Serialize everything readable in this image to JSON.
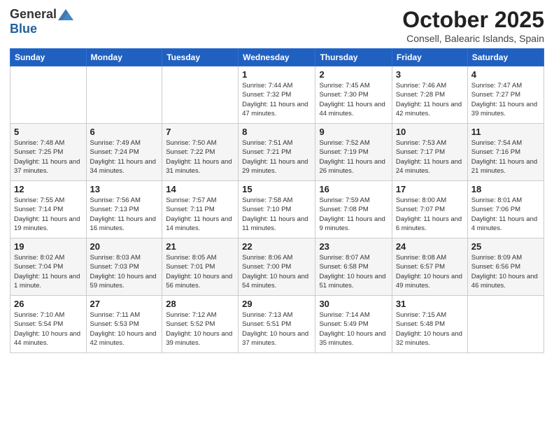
{
  "header": {
    "logo_general": "General",
    "logo_blue": "Blue",
    "month_title": "October 2025",
    "location": "Consell, Balearic Islands, Spain"
  },
  "weekdays": [
    "Sunday",
    "Monday",
    "Tuesday",
    "Wednesday",
    "Thursday",
    "Friday",
    "Saturday"
  ],
  "weeks": [
    [
      {
        "day": "",
        "info": ""
      },
      {
        "day": "",
        "info": ""
      },
      {
        "day": "",
        "info": ""
      },
      {
        "day": "1",
        "info": "Sunrise: 7:44 AM\nSunset: 7:32 PM\nDaylight: 11 hours\nand 47 minutes."
      },
      {
        "day": "2",
        "info": "Sunrise: 7:45 AM\nSunset: 7:30 PM\nDaylight: 11 hours\nand 44 minutes."
      },
      {
        "day": "3",
        "info": "Sunrise: 7:46 AM\nSunset: 7:28 PM\nDaylight: 11 hours\nand 42 minutes."
      },
      {
        "day": "4",
        "info": "Sunrise: 7:47 AM\nSunset: 7:27 PM\nDaylight: 11 hours\nand 39 minutes."
      }
    ],
    [
      {
        "day": "5",
        "info": "Sunrise: 7:48 AM\nSunset: 7:25 PM\nDaylight: 11 hours\nand 37 minutes."
      },
      {
        "day": "6",
        "info": "Sunrise: 7:49 AM\nSunset: 7:24 PM\nDaylight: 11 hours\nand 34 minutes."
      },
      {
        "day": "7",
        "info": "Sunrise: 7:50 AM\nSunset: 7:22 PM\nDaylight: 11 hours\nand 31 minutes."
      },
      {
        "day": "8",
        "info": "Sunrise: 7:51 AM\nSunset: 7:21 PM\nDaylight: 11 hours\nand 29 minutes."
      },
      {
        "day": "9",
        "info": "Sunrise: 7:52 AM\nSunset: 7:19 PM\nDaylight: 11 hours\nand 26 minutes."
      },
      {
        "day": "10",
        "info": "Sunrise: 7:53 AM\nSunset: 7:17 PM\nDaylight: 11 hours\nand 24 minutes."
      },
      {
        "day": "11",
        "info": "Sunrise: 7:54 AM\nSunset: 7:16 PM\nDaylight: 11 hours\nand 21 minutes."
      }
    ],
    [
      {
        "day": "12",
        "info": "Sunrise: 7:55 AM\nSunset: 7:14 PM\nDaylight: 11 hours\nand 19 minutes."
      },
      {
        "day": "13",
        "info": "Sunrise: 7:56 AM\nSunset: 7:13 PM\nDaylight: 11 hours\nand 16 minutes."
      },
      {
        "day": "14",
        "info": "Sunrise: 7:57 AM\nSunset: 7:11 PM\nDaylight: 11 hours\nand 14 minutes."
      },
      {
        "day": "15",
        "info": "Sunrise: 7:58 AM\nSunset: 7:10 PM\nDaylight: 11 hours\nand 11 minutes."
      },
      {
        "day": "16",
        "info": "Sunrise: 7:59 AM\nSunset: 7:08 PM\nDaylight: 11 hours\nand 9 minutes."
      },
      {
        "day": "17",
        "info": "Sunrise: 8:00 AM\nSunset: 7:07 PM\nDaylight: 11 hours\nand 6 minutes."
      },
      {
        "day": "18",
        "info": "Sunrise: 8:01 AM\nSunset: 7:06 PM\nDaylight: 11 hours\nand 4 minutes."
      }
    ],
    [
      {
        "day": "19",
        "info": "Sunrise: 8:02 AM\nSunset: 7:04 PM\nDaylight: 11 hours\nand 1 minute."
      },
      {
        "day": "20",
        "info": "Sunrise: 8:03 AM\nSunset: 7:03 PM\nDaylight: 10 hours\nand 59 minutes."
      },
      {
        "day": "21",
        "info": "Sunrise: 8:05 AM\nSunset: 7:01 PM\nDaylight: 10 hours\nand 56 minutes."
      },
      {
        "day": "22",
        "info": "Sunrise: 8:06 AM\nSunset: 7:00 PM\nDaylight: 10 hours\nand 54 minutes."
      },
      {
        "day": "23",
        "info": "Sunrise: 8:07 AM\nSunset: 6:58 PM\nDaylight: 10 hours\nand 51 minutes."
      },
      {
        "day": "24",
        "info": "Sunrise: 8:08 AM\nSunset: 6:57 PM\nDaylight: 10 hours\nand 49 minutes."
      },
      {
        "day": "25",
        "info": "Sunrise: 8:09 AM\nSunset: 6:56 PM\nDaylight: 10 hours\nand 46 minutes."
      }
    ],
    [
      {
        "day": "26",
        "info": "Sunrise: 7:10 AM\nSunset: 5:54 PM\nDaylight: 10 hours\nand 44 minutes."
      },
      {
        "day": "27",
        "info": "Sunrise: 7:11 AM\nSunset: 5:53 PM\nDaylight: 10 hours\nand 42 minutes."
      },
      {
        "day": "28",
        "info": "Sunrise: 7:12 AM\nSunset: 5:52 PM\nDaylight: 10 hours\nand 39 minutes."
      },
      {
        "day": "29",
        "info": "Sunrise: 7:13 AM\nSunset: 5:51 PM\nDaylight: 10 hours\nand 37 minutes."
      },
      {
        "day": "30",
        "info": "Sunrise: 7:14 AM\nSunset: 5:49 PM\nDaylight: 10 hours\nand 35 minutes."
      },
      {
        "day": "31",
        "info": "Sunrise: 7:15 AM\nSunset: 5:48 PM\nDaylight: 10 hours\nand 32 minutes."
      },
      {
        "day": "",
        "info": ""
      }
    ]
  ]
}
